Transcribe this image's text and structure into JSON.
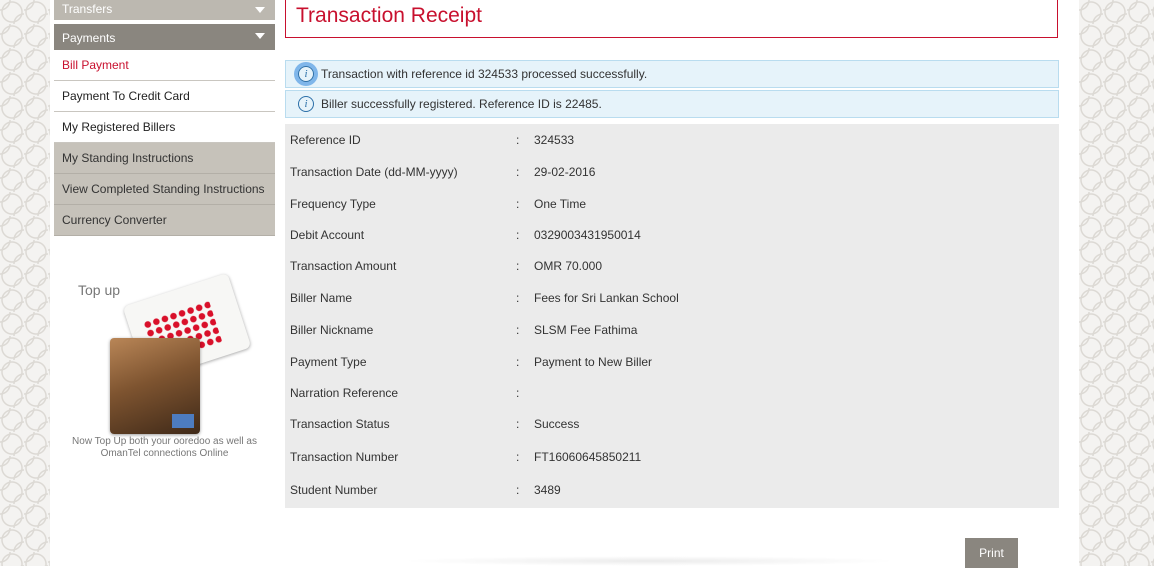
{
  "sidebar": {
    "transfers": "Transfers",
    "payments": "Payments",
    "items": [
      {
        "label": "Bill Payment"
      },
      {
        "label": "Payment To Credit Card"
      },
      {
        "label": "My Registered Billers"
      },
      {
        "label": "My Standing Instructions"
      },
      {
        "label": "View Completed Standing Instructions"
      },
      {
        "label": "Currency Converter"
      }
    ],
    "topup": {
      "title": "Top up",
      "text": "Now Top Up both your ooredoo as well as OmanTel connections Online"
    }
  },
  "page_title": "Transaction Receipt",
  "messages": [
    "Transaction with reference id 324533 processed successfully.",
    "Biller successfully registered. Reference ID is 22485."
  ],
  "colon": ":",
  "details": [
    {
      "label": "Reference ID",
      "value": "324533"
    },
    {
      "label": "Transaction Date (dd-MM-yyyy)",
      "value": "29-02-2016"
    },
    {
      "label": "Frequency Type",
      "value": "One Time"
    },
    {
      "label": "Debit Account",
      "value": "0329003431950014"
    },
    {
      "label": "Transaction Amount",
      "value": "OMR 70.000"
    },
    {
      "label": "Biller Name",
      "value": "Fees for Sri Lankan School"
    },
    {
      "label": "Biller Nickname",
      "value": "SLSM Fee Fathima"
    },
    {
      "label": "Payment Type",
      "value": "Payment to New Biller"
    },
    {
      "label": "Narration Reference",
      "value": ""
    },
    {
      "label": "Transaction Status",
      "value": "Success"
    },
    {
      "label": "Transaction Number",
      "value": "FT16060645850211"
    },
    {
      "label": "Student Number",
      "value": "3489"
    }
  ],
  "print_label": "Print",
  "colors": {
    "accent": "#c8102e",
    "sidebar_gray": "#c6c2ba",
    "info_bg": "#e6f3fa"
  },
  "icons": {
    "info": "info-icon",
    "caret": "chevron-down-icon"
  }
}
